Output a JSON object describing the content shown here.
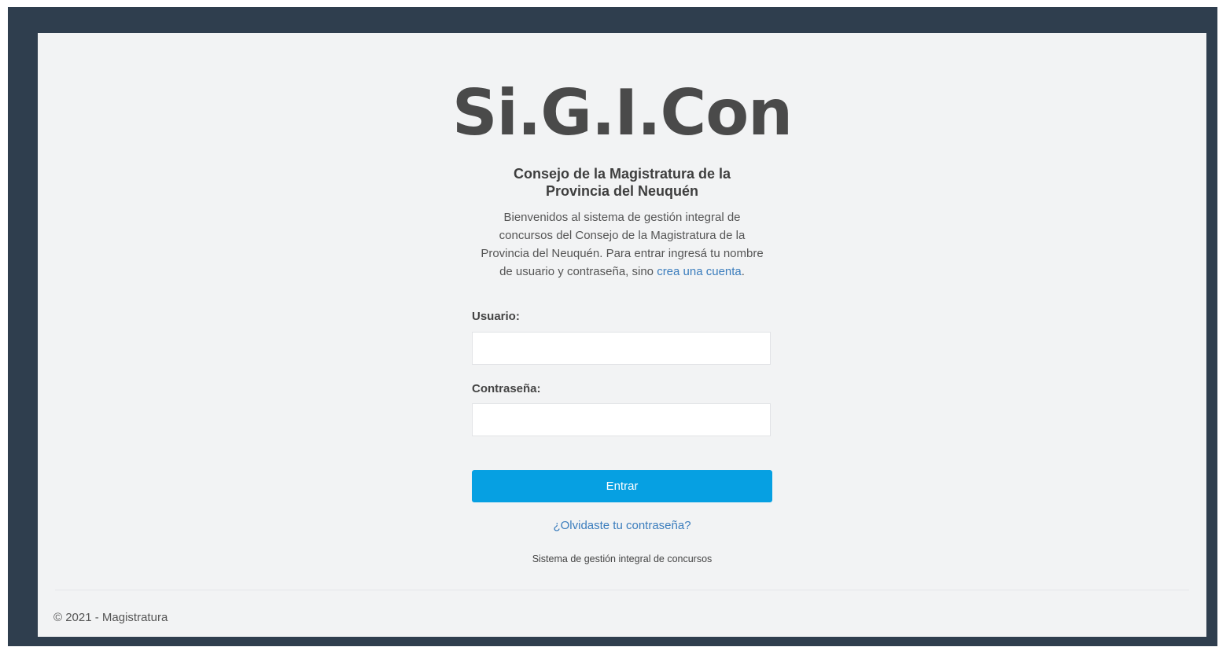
{
  "brand": {
    "title": "Si.G.I.Con"
  },
  "organization": {
    "line1": "Consejo de la Magistratura de la",
    "line2": "Provincia del Neuquén"
  },
  "intro": {
    "text": "Bienvenidos al sistema de gestión integral de concursos del Consejo de la Magistratura de la Provincia del Neuquén. Para entrar ingresá tu nombre de usuario y contraseña, sino",
    "link_label": "crea una cuenta",
    "trailing": "."
  },
  "form": {
    "username_label": "Usuario:",
    "username_value": "",
    "password_label": "Contraseña:",
    "password_value": "",
    "submit_label": "Entrar",
    "forgot_label": "¿Olvidaste tu contraseña?"
  },
  "tagline": "Sistema de gestión integral de concursos",
  "footer": {
    "copyright": "© 2021 - Magistratura"
  },
  "colors": {
    "frame": "#2f3e4e",
    "panel": "#f2f3f4",
    "accent": "#06a0e2",
    "link": "#3b7dbd",
    "title": "#4a4a4a"
  }
}
